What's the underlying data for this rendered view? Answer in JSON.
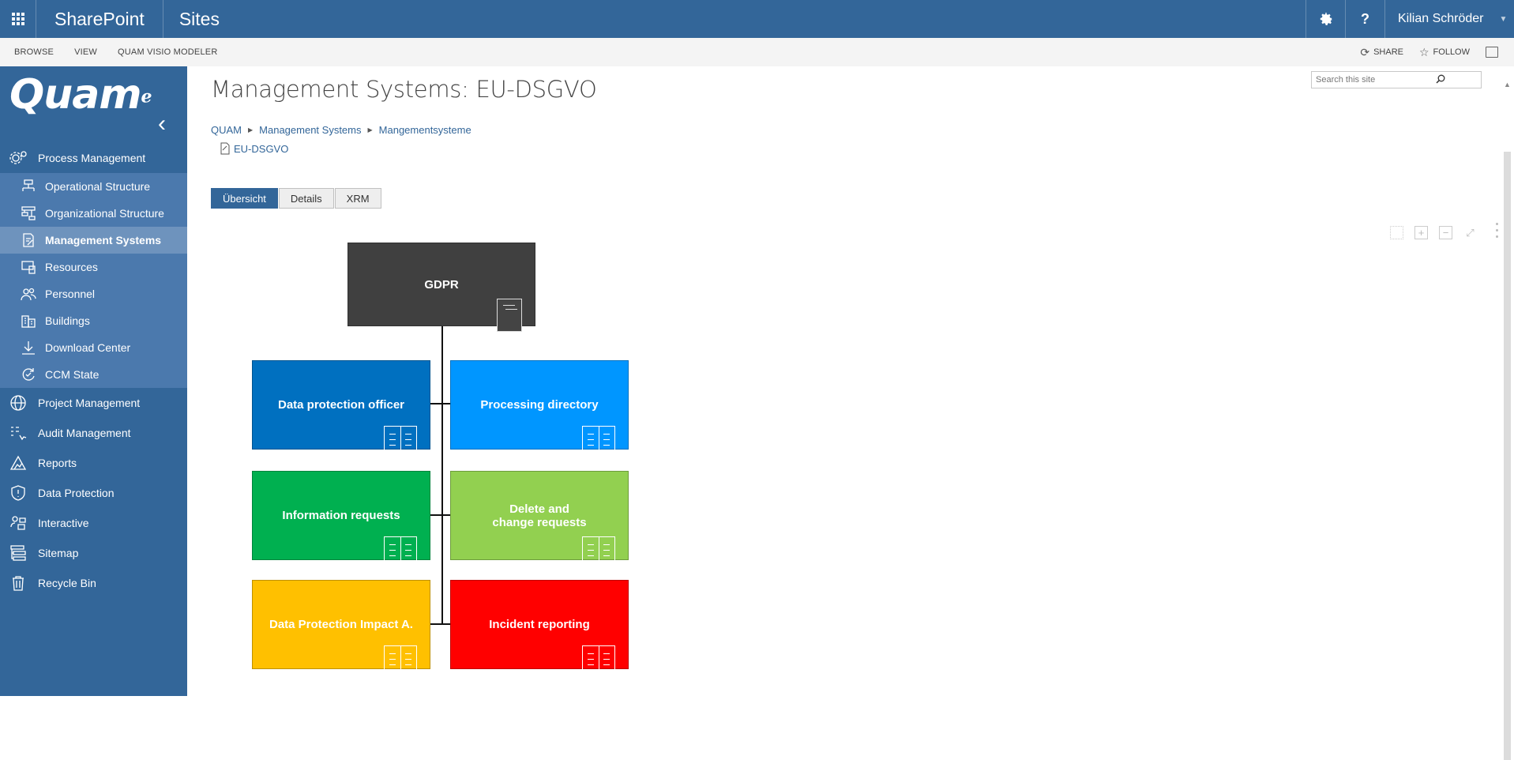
{
  "suitebar": {
    "brand": "SharePoint",
    "sites": "Sites",
    "help": "?",
    "user": "Kilian Schröder",
    "icons": [
      "app-launcher-icon",
      "gear-icon",
      "help-icon",
      "chevron-down-icon"
    ]
  },
  "ribbon": {
    "tabs": [
      "BROWSE",
      "VIEW",
      "QUAM VISIO MODELER"
    ],
    "share": "SHARE",
    "follow": "FOLLOW"
  },
  "leftnav": {
    "logo": "Quam",
    "groups": [
      {
        "label": "Process Management",
        "icon": "gears-icon"
      }
    ],
    "sub_items": [
      {
        "label": "Operational Structure",
        "icon": "flowchart-icon"
      },
      {
        "label": "Organizational Structure",
        "icon": "org-chart-icon"
      },
      {
        "label": "Management Systems",
        "icon": "document-edit-icon",
        "active": true
      },
      {
        "label": "Resources",
        "icon": "devices-icon"
      },
      {
        "label": "Personnel",
        "icon": "people-icon"
      },
      {
        "label": "Buildings",
        "icon": "building-icon"
      },
      {
        "label": "Download Center",
        "icon": "download-icon"
      },
      {
        "label": "CCM State",
        "icon": "cycle-icon"
      }
    ],
    "items": [
      {
        "label": "Project Management",
        "icon": "globe-icon"
      },
      {
        "label": "Audit Management",
        "icon": "list-check-icon"
      },
      {
        "label": "Reports",
        "icon": "chart-icon"
      },
      {
        "label": "Data Protection",
        "icon": "shield-icon"
      },
      {
        "label": "Interactive",
        "icon": "interactive-icon"
      },
      {
        "label": "Sitemap",
        "icon": "sitemap-icon"
      },
      {
        "label": "Recycle Bin",
        "icon": "trash-icon"
      }
    ]
  },
  "main": {
    "title": "Management Systems: EU-DSGVO",
    "search_placeholder": "Search this site",
    "breadcrumb": [
      "QUAM",
      "Management Systems",
      "Mangementsysteme"
    ],
    "document": "EU-DSGVO",
    "tabs": [
      "Übersicht",
      "Details",
      "XRM"
    ],
    "active_tab": "Übersicht"
  },
  "diagram": {
    "root": {
      "label": "GDPR",
      "color": "#404040"
    },
    "children": [
      {
        "label": "Data protection officer",
        "color": "#0070c0"
      },
      {
        "label": "Processing directory",
        "color": "#0096ff"
      },
      {
        "label": "Information requests",
        "color": "#00b050"
      },
      {
        "label": "Delete and\nchange requests",
        "color": "#92d050"
      },
      {
        "label": "Data Protection Impact A.",
        "color": "#ffc000"
      },
      {
        "label": "Incident reporting",
        "color": "#ff0000"
      }
    ]
  },
  "colors": {
    "brand_blue": "#336699",
    "subnav_bg": "#4b79ad",
    "subnav_active": "#6e93bd"
  }
}
